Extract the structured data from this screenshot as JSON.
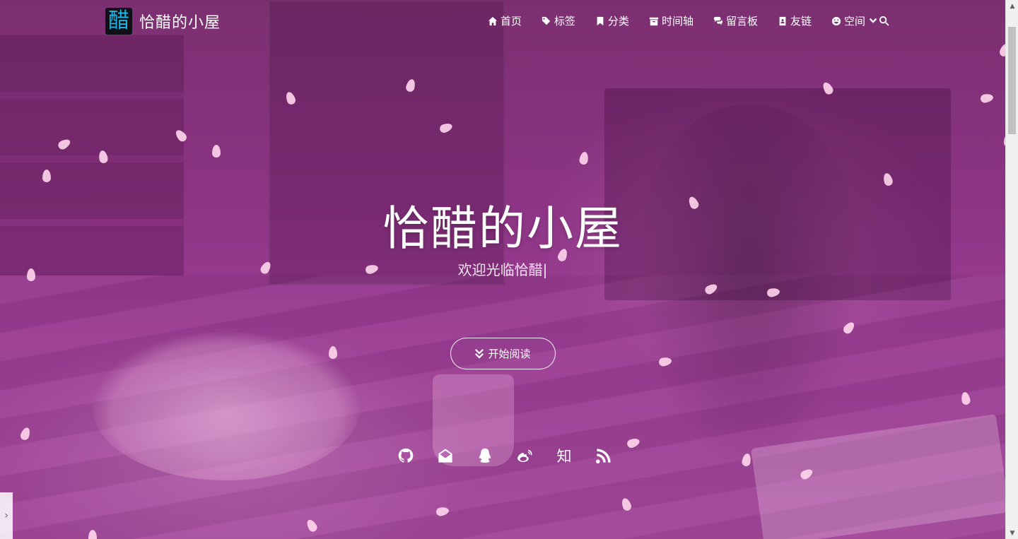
{
  "brand": {
    "logo_char": "醋",
    "name": "恰醋的小屋"
  },
  "nav": {
    "items": [
      {
        "label": "首页",
        "icon": "home-icon"
      },
      {
        "label": "标签",
        "icon": "tags-icon"
      },
      {
        "label": "分类",
        "icon": "bookmark-icon"
      },
      {
        "label": "时间轴",
        "icon": "archive-icon"
      },
      {
        "label": "留言板",
        "icon": "comments-icon"
      },
      {
        "label": "友链",
        "icon": "address-book-icon"
      },
      {
        "label": "空间",
        "icon": "smile-icon"
      }
    ],
    "search_icon": "search-icon",
    "dropdown_icon": "chevron-down-icon"
  },
  "hero": {
    "title": "恰醋的小屋",
    "subtitle": "欢迎光临恰醋|",
    "start_button": "开始阅读"
  },
  "social": {
    "items": [
      {
        "name": "github-icon"
      },
      {
        "name": "email-icon"
      },
      {
        "name": "qq-icon"
      },
      {
        "name": "weibo-icon"
      },
      {
        "name": "zhihu-icon",
        "text": "知"
      },
      {
        "name": "rss-icon"
      }
    ]
  },
  "colors": {
    "overlay": "#8b3483",
    "text": "#ffffff",
    "petal": "#ffd6ec"
  },
  "side_tab": {
    "glyph": "›"
  }
}
